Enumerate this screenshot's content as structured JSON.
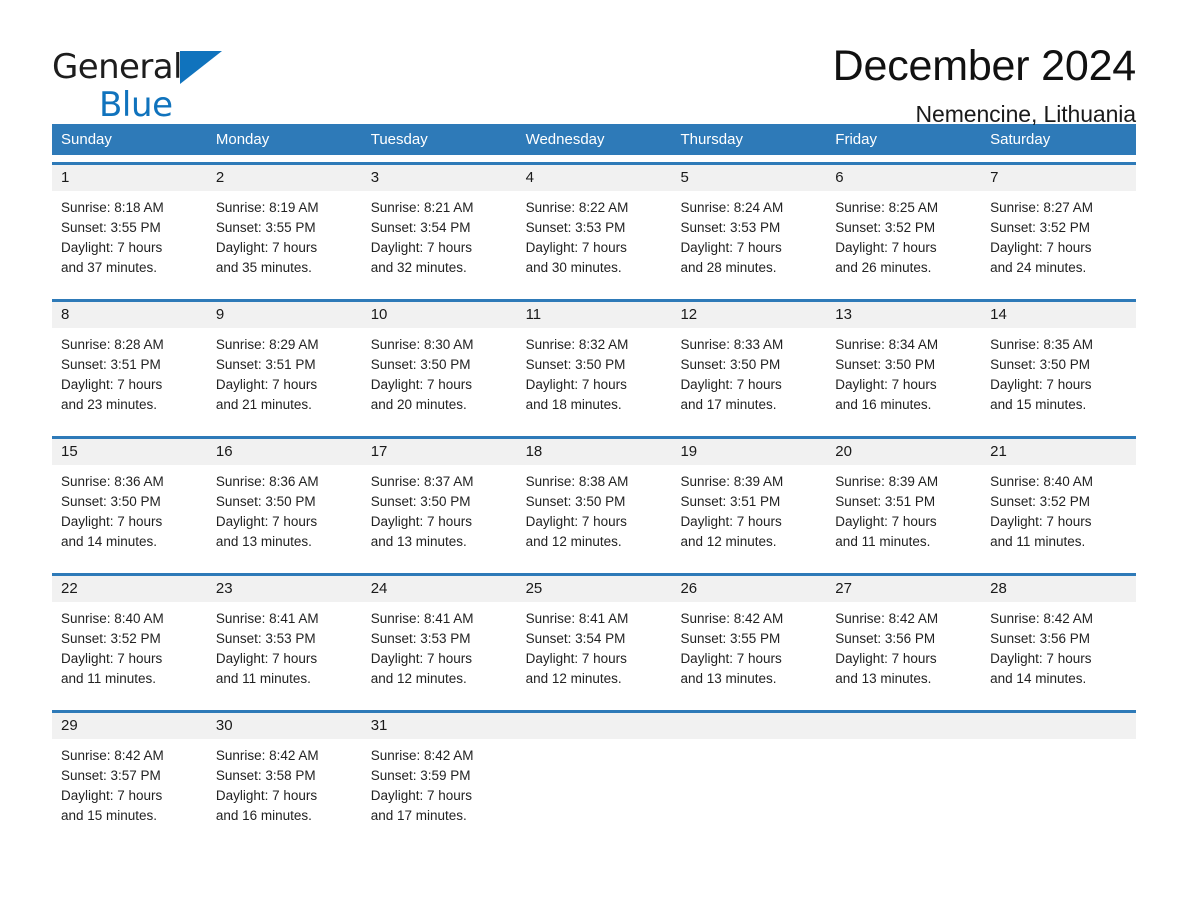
{
  "brand": {
    "word1": "General",
    "word2": "Blue",
    "triangle_icon": "triangle-logo-icon",
    "accent_color": "#1073bd"
  },
  "header": {
    "month_title": "December 2024",
    "location": "Nemencine, Lithuania"
  },
  "calendar": {
    "header_color": "#2e7ab8",
    "daynum_band_color": "#f1f1f1",
    "weekdays": [
      "Sunday",
      "Monday",
      "Tuesday",
      "Wednesday",
      "Thursday",
      "Friday",
      "Saturday"
    ],
    "weeks": [
      [
        {
          "day": "1",
          "sunrise": "Sunrise: 8:18 AM",
          "sunset": "Sunset: 3:55 PM",
          "daylight1": "Daylight: 7 hours",
          "daylight2": "and 37 minutes."
        },
        {
          "day": "2",
          "sunrise": "Sunrise: 8:19 AM",
          "sunset": "Sunset: 3:55 PM",
          "daylight1": "Daylight: 7 hours",
          "daylight2": "and 35 minutes."
        },
        {
          "day": "3",
          "sunrise": "Sunrise: 8:21 AM",
          "sunset": "Sunset: 3:54 PM",
          "daylight1": "Daylight: 7 hours",
          "daylight2": "and 32 minutes."
        },
        {
          "day": "4",
          "sunrise": "Sunrise: 8:22 AM",
          "sunset": "Sunset: 3:53 PM",
          "daylight1": "Daylight: 7 hours",
          "daylight2": "and 30 minutes."
        },
        {
          "day": "5",
          "sunrise": "Sunrise: 8:24 AM",
          "sunset": "Sunset: 3:53 PM",
          "daylight1": "Daylight: 7 hours",
          "daylight2": "and 28 minutes."
        },
        {
          "day": "6",
          "sunrise": "Sunrise: 8:25 AM",
          "sunset": "Sunset: 3:52 PM",
          "daylight1": "Daylight: 7 hours",
          "daylight2": "and 26 minutes."
        },
        {
          "day": "7",
          "sunrise": "Sunrise: 8:27 AM",
          "sunset": "Sunset: 3:52 PM",
          "daylight1": "Daylight: 7 hours",
          "daylight2": "and 24 minutes."
        }
      ],
      [
        {
          "day": "8",
          "sunrise": "Sunrise: 8:28 AM",
          "sunset": "Sunset: 3:51 PM",
          "daylight1": "Daylight: 7 hours",
          "daylight2": "and 23 minutes."
        },
        {
          "day": "9",
          "sunrise": "Sunrise: 8:29 AM",
          "sunset": "Sunset: 3:51 PM",
          "daylight1": "Daylight: 7 hours",
          "daylight2": "and 21 minutes."
        },
        {
          "day": "10",
          "sunrise": "Sunrise: 8:30 AM",
          "sunset": "Sunset: 3:50 PM",
          "daylight1": "Daylight: 7 hours",
          "daylight2": "and 20 minutes."
        },
        {
          "day": "11",
          "sunrise": "Sunrise: 8:32 AM",
          "sunset": "Sunset: 3:50 PM",
          "daylight1": "Daylight: 7 hours",
          "daylight2": "and 18 minutes."
        },
        {
          "day": "12",
          "sunrise": "Sunrise: 8:33 AM",
          "sunset": "Sunset: 3:50 PM",
          "daylight1": "Daylight: 7 hours",
          "daylight2": "and 17 minutes."
        },
        {
          "day": "13",
          "sunrise": "Sunrise: 8:34 AM",
          "sunset": "Sunset: 3:50 PM",
          "daylight1": "Daylight: 7 hours",
          "daylight2": "and 16 minutes."
        },
        {
          "day": "14",
          "sunrise": "Sunrise: 8:35 AM",
          "sunset": "Sunset: 3:50 PM",
          "daylight1": "Daylight: 7 hours",
          "daylight2": "and 15 minutes."
        }
      ],
      [
        {
          "day": "15",
          "sunrise": "Sunrise: 8:36 AM",
          "sunset": "Sunset: 3:50 PM",
          "daylight1": "Daylight: 7 hours",
          "daylight2": "and 14 minutes."
        },
        {
          "day": "16",
          "sunrise": "Sunrise: 8:36 AM",
          "sunset": "Sunset: 3:50 PM",
          "daylight1": "Daylight: 7 hours",
          "daylight2": "and 13 minutes."
        },
        {
          "day": "17",
          "sunrise": "Sunrise: 8:37 AM",
          "sunset": "Sunset: 3:50 PM",
          "daylight1": "Daylight: 7 hours",
          "daylight2": "and 13 minutes."
        },
        {
          "day": "18",
          "sunrise": "Sunrise: 8:38 AM",
          "sunset": "Sunset: 3:50 PM",
          "daylight1": "Daylight: 7 hours",
          "daylight2": "and 12 minutes."
        },
        {
          "day": "19",
          "sunrise": "Sunrise: 8:39 AM",
          "sunset": "Sunset: 3:51 PM",
          "daylight1": "Daylight: 7 hours",
          "daylight2": "and 12 minutes."
        },
        {
          "day": "20",
          "sunrise": "Sunrise: 8:39 AM",
          "sunset": "Sunset: 3:51 PM",
          "daylight1": "Daylight: 7 hours",
          "daylight2": "and 11 minutes."
        },
        {
          "day": "21",
          "sunrise": "Sunrise: 8:40 AM",
          "sunset": "Sunset: 3:52 PM",
          "daylight1": "Daylight: 7 hours",
          "daylight2": "and 11 minutes."
        }
      ],
      [
        {
          "day": "22",
          "sunrise": "Sunrise: 8:40 AM",
          "sunset": "Sunset: 3:52 PM",
          "daylight1": "Daylight: 7 hours",
          "daylight2": "and 11 minutes."
        },
        {
          "day": "23",
          "sunrise": "Sunrise: 8:41 AM",
          "sunset": "Sunset: 3:53 PM",
          "daylight1": "Daylight: 7 hours",
          "daylight2": "and 11 minutes."
        },
        {
          "day": "24",
          "sunrise": "Sunrise: 8:41 AM",
          "sunset": "Sunset: 3:53 PM",
          "daylight1": "Daylight: 7 hours",
          "daylight2": "and 12 minutes."
        },
        {
          "day": "25",
          "sunrise": "Sunrise: 8:41 AM",
          "sunset": "Sunset: 3:54 PM",
          "daylight1": "Daylight: 7 hours",
          "daylight2": "and 12 minutes."
        },
        {
          "day": "26",
          "sunrise": "Sunrise: 8:42 AM",
          "sunset": "Sunset: 3:55 PM",
          "daylight1": "Daylight: 7 hours",
          "daylight2": "and 13 minutes."
        },
        {
          "day": "27",
          "sunrise": "Sunrise: 8:42 AM",
          "sunset": "Sunset: 3:56 PM",
          "daylight1": "Daylight: 7 hours",
          "daylight2": "and 13 minutes."
        },
        {
          "day": "28",
          "sunrise": "Sunrise: 8:42 AM",
          "sunset": "Sunset: 3:56 PM",
          "daylight1": "Daylight: 7 hours",
          "daylight2": "and 14 minutes."
        }
      ],
      [
        {
          "day": "29",
          "sunrise": "Sunrise: 8:42 AM",
          "sunset": "Sunset: 3:57 PM",
          "daylight1": "Daylight: 7 hours",
          "daylight2": "and 15 minutes."
        },
        {
          "day": "30",
          "sunrise": "Sunrise: 8:42 AM",
          "sunset": "Sunset: 3:58 PM",
          "daylight1": "Daylight: 7 hours",
          "daylight2": "and 16 minutes."
        },
        {
          "day": "31",
          "sunrise": "Sunrise: 8:42 AM",
          "sunset": "Sunset: 3:59 PM",
          "daylight1": "Daylight: 7 hours",
          "daylight2": "and 17 minutes."
        },
        {
          "day": "",
          "sunrise": "",
          "sunset": "",
          "daylight1": "",
          "daylight2": ""
        },
        {
          "day": "",
          "sunrise": "",
          "sunset": "",
          "daylight1": "",
          "daylight2": ""
        },
        {
          "day": "",
          "sunrise": "",
          "sunset": "",
          "daylight1": "",
          "daylight2": ""
        },
        {
          "day": "",
          "sunrise": "",
          "sunset": "",
          "daylight1": "",
          "daylight2": ""
        }
      ]
    ]
  }
}
